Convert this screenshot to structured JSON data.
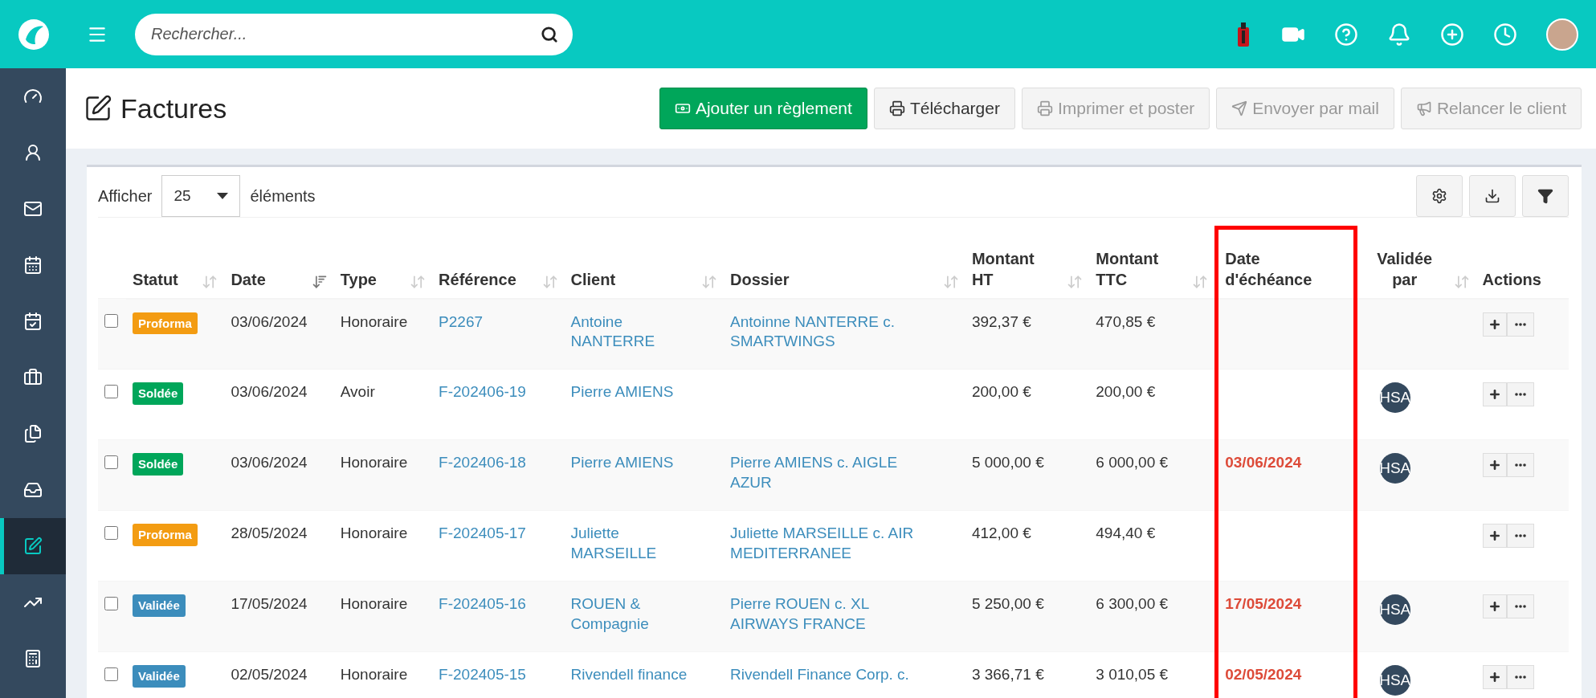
{
  "search": {
    "placeholder": "Rechercher..."
  },
  "sidebar": {
    "items": [
      {
        "kind": "gauge",
        "selected": false
      },
      {
        "kind": "user",
        "selected": false
      },
      {
        "kind": "mail",
        "selected": false
      },
      {
        "kind": "calendar",
        "selected": false
      },
      {
        "kind": "calendar-check",
        "selected": false
      },
      {
        "kind": "briefcase",
        "selected": false
      },
      {
        "kind": "files",
        "selected": false
      },
      {
        "kind": "tray",
        "selected": false
      },
      {
        "kind": "edit",
        "selected": true
      },
      {
        "kind": "chart",
        "selected": false
      },
      {
        "kind": "calculator",
        "selected": false
      }
    ]
  },
  "page": {
    "title": "Factures"
  },
  "actions": [
    {
      "label": "Ajouter un règlement",
      "kind": "money",
      "primary": true,
      "disabled": false
    },
    {
      "label": "Télécharger",
      "kind": "print",
      "primary": false,
      "disabled": false
    },
    {
      "label": "Imprimer et poster",
      "kind": "print",
      "primary": false,
      "disabled": true
    },
    {
      "label": "Envoyer par mail",
      "kind": "send",
      "primary": false,
      "disabled": true
    },
    {
      "label": "Relancer le client",
      "kind": "megaphone",
      "primary": false,
      "disabled": true
    }
  ],
  "length_menu": {
    "before": "Afficher",
    "value": "25",
    "after": "éléments"
  },
  "table": {
    "columns": [
      {
        "label": "Statut",
        "sortable": true,
        "sorted": false,
        "highlighted": false
      },
      {
        "label": "Date",
        "sortable": true,
        "sorted": true,
        "highlighted": false
      },
      {
        "label": "Type",
        "sortable": true,
        "sorted": false,
        "highlighted": false
      },
      {
        "label": "Référence",
        "sortable": true,
        "sorted": false,
        "highlighted": false
      },
      {
        "label": "Client",
        "sortable": true,
        "sorted": false,
        "highlighted": false
      },
      {
        "label": "Dossier",
        "sortable": true,
        "sorted": false,
        "highlighted": false
      },
      {
        "label": "Montant HT",
        "sortable": true,
        "sorted": false,
        "highlighted": false
      },
      {
        "label": "Montant TTC",
        "sortable": true,
        "sorted": false,
        "highlighted": false
      },
      {
        "label": "Date d'échéance",
        "sortable": false,
        "highlighted": true
      },
      {
        "label": "Validée par",
        "sortable": true,
        "sorted": false,
        "highlighted": false
      },
      {
        "label": "Actions",
        "sortable": false,
        "highlighted": false
      }
    ],
    "rows": [
      {
        "checked": false,
        "status": {
          "label": "Proforma",
          "kind": "proforma"
        },
        "date": "03/06/2024",
        "type": "Honoraire",
        "reference": "P2267",
        "client": "Antoine NANTERRE",
        "dossier": "Antoinne NANTERRE c. SMARTWINGS",
        "ht": "392,37 €",
        "ttc": "470,85 €"
      },
      {
        "checked": false,
        "status": {
          "label": "Soldée",
          "kind": "paid"
        },
        "date": "03/06/2024",
        "type": "Avoir",
        "reference": "F-202406-19",
        "client": "Pierre AMIENS",
        "ht": "200,00 €",
        "ttc": "200,00 €",
        "validator": "HSA"
      },
      {
        "checked": false,
        "status": {
          "label": "Soldée",
          "kind": "paid"
        },
        "date": "03/06/2024",
        "type": "Honoraire",
        "reference": "F-202406-18",
        "client": "Pierre AMIENS",
        "dossier": "Pierre AMIENS c. AIGLE AZUR",
        "ht": "5 000,00 €",
        "ttc": "6 000,00 €",
        "due": "03/06/2024",
        "validator": "HSA"
      },
      {
        "checked": false,
        "status": {
          "label": "Proforma",
          "kind": "proforma"
        },
        "date": "28/05/2024",
        "type": "Honoraire",
        "reference": "F-202405-17",
        "client": "Juliette MARSEILLE",
        "dossier": "Juliette MARSEILLE c. AIR MEDITERRANEE",
        "ht": "412,00 €",
        "ttc": "494,40 €"
      },
      {
        "checked": false,
        "status": {
          "label": "Validée",
          "kind": "validated"
        },
        "date": "17/05/2024",
        "type": "Honoraire",
        "reference": "F-202405-16",
        "client": "ROUEN & Compagnie",
        "dossier": "Pierre ROUEN c. XL AIRWAYS FRANCE",
        "ht": "5 250,00 €",
        "ttc": "6 300,00 €",
        "due": "17/05/2024",
        "validator": "HSA"
      },
      {
        "checked": false,
        "status": {
          "label": "Validée",
          "kind": "validated"
        },
        "date": "02/05/2024",
        "type": "Honoraire",
        "reference": "F-202405-15",
        "client": "Rivendell finance",
        "dossier": "Rivendell Finance Corp. c.",
        "ht": "3 366,71 €",
        "ttc": "3 010,05 €",
        "due": "02/05/2024",
        "validator": "HSA"
      }
    ]
  }
}
